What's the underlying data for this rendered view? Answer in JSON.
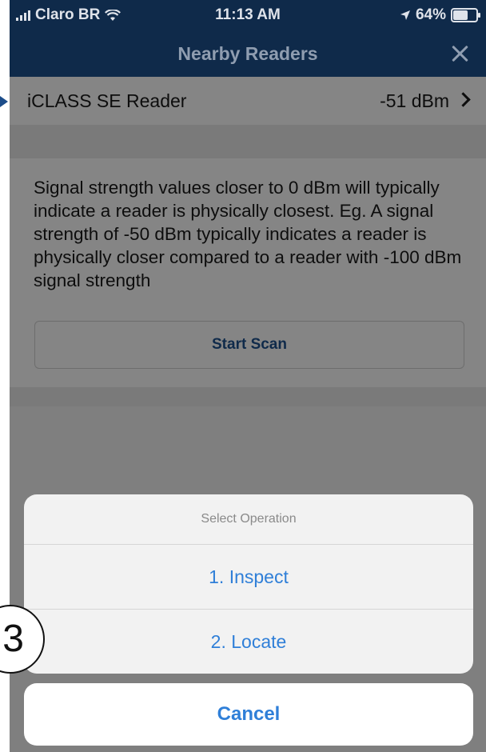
{
  "status_bar": {
    "carrier": "Claro BR",
    "time": "11:13 AM",
    "battery": "64%",
    "battery_level": 0.64,
    "icons": [
      "signal-icon",
      "wifi-icon",
      "location-icon",
      "battery-icon"
    ]
  },
  "nav": {
    "title": "Nearby Readers",
    "close_icon": "close-icon"
  },
  "readers": [
    {
      "name": "iCLASS SE Reader",
      "signal": "-51 dBm"
    }
  ],
  "info": {
    "text": "Signal strength values closer to 0 dBm will typically indicate a reader is physically closest. Eg. A signal strength of -50 dBm typically indicates a reader is physically closer compared to a reader with -100 dBm signal strength",
    "scan_button": "Start Scan"
  },
  "action_sheet": {
    "title": "Select Operation",
    "options": [
      "1. Inspect",
      "2. Locate"
    ],
    "cancel": "Cancel"
  },
  "annotation": {
    "step_number": "3"
  },
  "colors": {
    "nav_background": "#0f2a4a",
    "action_text": "#2f7fd8",
    "scan_button_text": "#0f2a4a"
  }
}
